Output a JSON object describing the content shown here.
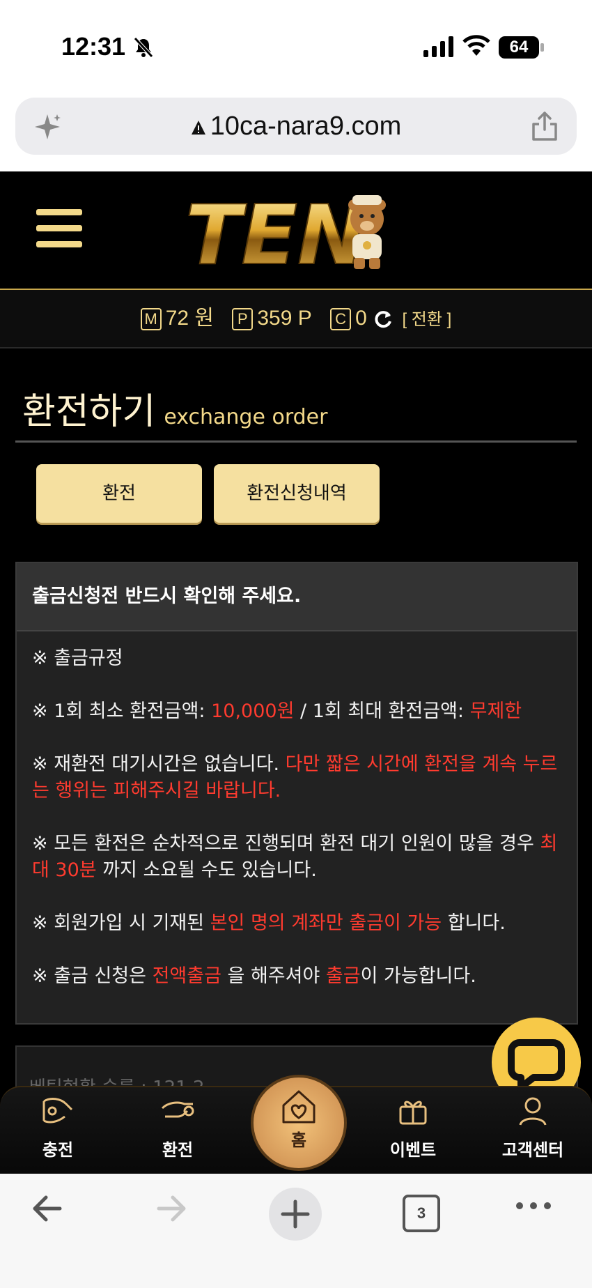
{
  "status": {
    "time": "12:31",
    "battery": "64"
  },
  "browser": {
    "url": "10ca-nara9.com",
    "tab_count": "3"
  },
  "site": {
    "logo_text": "TEN",
    "balance": {
      "money_badge": "M",
      "money": "72 원",
      "point_badge": "P",
      "point": "359 P",
      "coin_badge": "C",
      "coin": "0",
      "switch_label": "[ 전환 ]"
    }
  },
  "page": {
    "title": "환전하기",
    "subtitle": "exchange order",
    "tabs": [
      "환전",
      "환전신청내역"
    ]
  },
  "notice": {
    "heading": "출금신청전 반드시 확인해 주세요.",
    "rule_title": "※ 출금규정",
    "line1": {
      "a": "※ 1회 최소 환전금액: ",
      "b": "10,000원",
      "c": " / 1회 최대 환전금액: ",
      "d": "무제한"
    },
    "line2": {
      "a": "※ 재환전 대기시간은 없습니다. ",
      "b": "다만 짧은 시간에 환전을 계속 누르는 행위는 피해주시길 바랍니다."
    },
    "line3": {
      "a": "※ 모든 환전은 순차적으로 진행되며 환전 대기 인원이 많을 경우 ",
      "b": "최대 30분",
      "c": " 까지 소요될 수도 있습니다."
    },
    "line4": {
      "a": "※ 회원가입 시 기재된 ",
      "b": "본인 명의 계좌만 출금이 가능",
      "c": " 합니다."
    },
    "line5": {
      "a": "※ 출금 신청은 ",
      "b": "전액출금",
      "c": " 을 해주셔야 ",
      "d": "출금",
      "e": "이 가능합니다."
    }
  },
  "partial_text": "베팅현황   승률 : 121.2",
  "bottom_nav": {
    "charge": "충전",
    "exchange": "환전",
    "home": "홈",
    "event": "이벤트",
    "support": "고객센터"
  },
  "colors": {
    "accent": "#f3d98a",
    "button": "#f5e0a0",
    "warning": "#ff3b2f",
    "fab": "#f7c948"
  }
}
